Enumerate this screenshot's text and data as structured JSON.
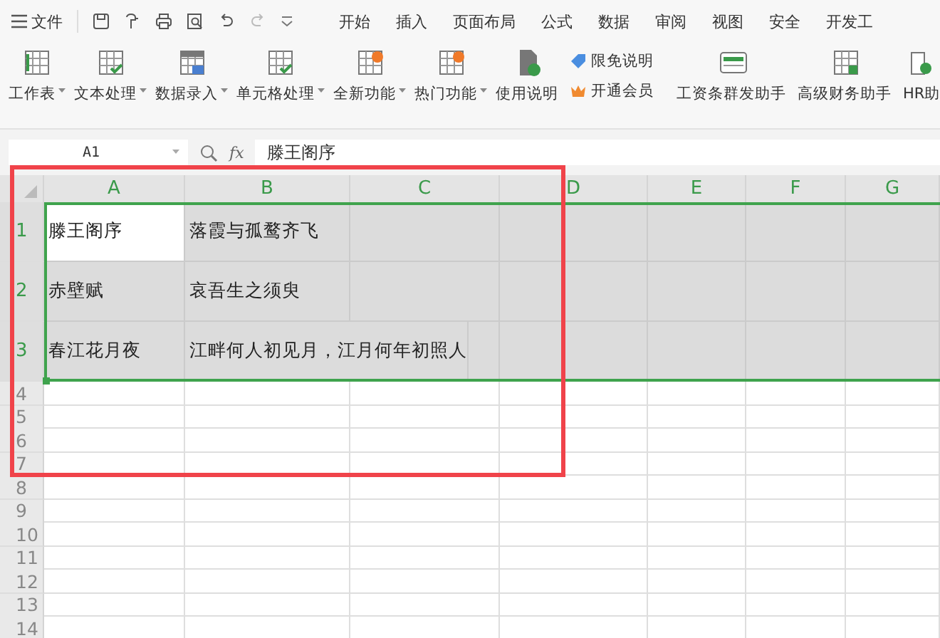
{
  "menu": {
    "file_label": "文件",
    "tabs": [
      {
        "label": "开始",
        "selected": false
      },
      {
        "label": "插入",
        "selected": false
      },
      {
        "label": "页面布局",
        "selected": false
      },
      {
        "label": "公式",
        "selected": false
      },
      {
        "label": "数据",
        "selected": false
      },
      {
        "label": "审阅",
        "selected": false
      },
      {
        "label": "视图",
        "selected": false
      },
      {
        "label": "安全",
        "selected": false
      },
      {
        "label": "开发工",
        "selected": false
      }
    ]
  },
  "ribbon": [
    {
      "kind": "large",
      "label": "工作表",
      "caret": true
    },
    {
      "kind": "large",
      "label": "文本处理",
      "caret": true
    },
    {
      "kind": "large",
      "label": "数据录入",
      "caret": true
    },
    {
      "kind": "large",
      "label": "单元格处理",
      "caret": true
    },
    {
      "kind": "large",
      "label": "全新功能",
      "caret": true
    },
    {
      "kind": "large",
      "label": "热门功能",
      "caret": true
    },
    {
      "kind": "large",
      "label": "使用说明",
      "caret": false
    },
    {
      "kind": "stack",
      "items": [
        {
          "label": "限免说明"
        },
        {
          "label": "开通会员"
        }
      ]
    },
    {
      "kind": "separator"
    },
    {
      "kind": "large",
      "label": "工资条群发助手",
      "caret": false
    },
    {
      "kind": "large",
      "label": "高级财务助手",
      "caret": false
    },
    {
      "kind": "large",
      "label": "HR助",
      "caret": false
    }
  ],
  "formula_bar": {
    "name_box": "A1",
    "fx": "fx",
    "value": "滕王阁序"
  },
  "sheet": {
    "columns": [
      {
        "label": "A",
        "selected": true
      },
      {
        "label": "B",
        "selected": true
      },
      {
        "label": "C",
        "selected": true
      },
      {
        "label": "D",
        "selected": true
      },
      {
        "label": "E",
        "selected": true
      },
      {
        "label": "F",
        "selected": true
      },
      {
        "label": "G",
        "selected": true
      }
    ],
    "rows": [
      {
        "header": "1",
        "selected": true,
        "cells": [
          {
            "text": "滕王阁序",
            "active": true
          },
          {
            "text": "落霞与孤鹜齐飞",
            "active": false
          }
        ]
      },
      {
        "header": "2",
        "selected": true,
        "cells": [
          {
            "text": "赤壁赋",
            "active": false
          },
          {
            "text": "哀吾生之须臾",
            "active": false
          }
        ]
      },
      {
        "header": "3",
        "selected": true,
        "cells": [
          {
            "text": "春江花月夜",
            "active": false
          },
          {
            "text": "江畔何人初见月，江月何年初照人",
            "active": false
          }
        ]
      },
      {
        "header": "4",
        "selected": false,
        "cells": []
      },
      {
        "header": "5",
        "selected": false,
        "cells": []
      },
      {
        "header": "6",
        "selected": false,
        "cells": []
      },
      {
        "header": "7",
        "selected": false,
        "cells": []
      },
      {
        "header": "8",
        "selected": false,
        "cells": []
      },
      {
        "header": "9",
        "selected": false,
        "cells": []
      },
      {
        "header": "10",
        "selected": false,
        "cells": []
      },
      {
        "header": "11",
        "selected": false,
        "cells": []
      },
      {
        "header": "12",
        "selected": false,
        "cells": []
      },
      {
        "header": "13",
        "selected": false,
        "cells": []
      },
      {
        "header": "14",
        "selected": false,
        "cells": []
      }
    ]
  },
  "annotation": {
    "kind": "red-frame"
  }
}
